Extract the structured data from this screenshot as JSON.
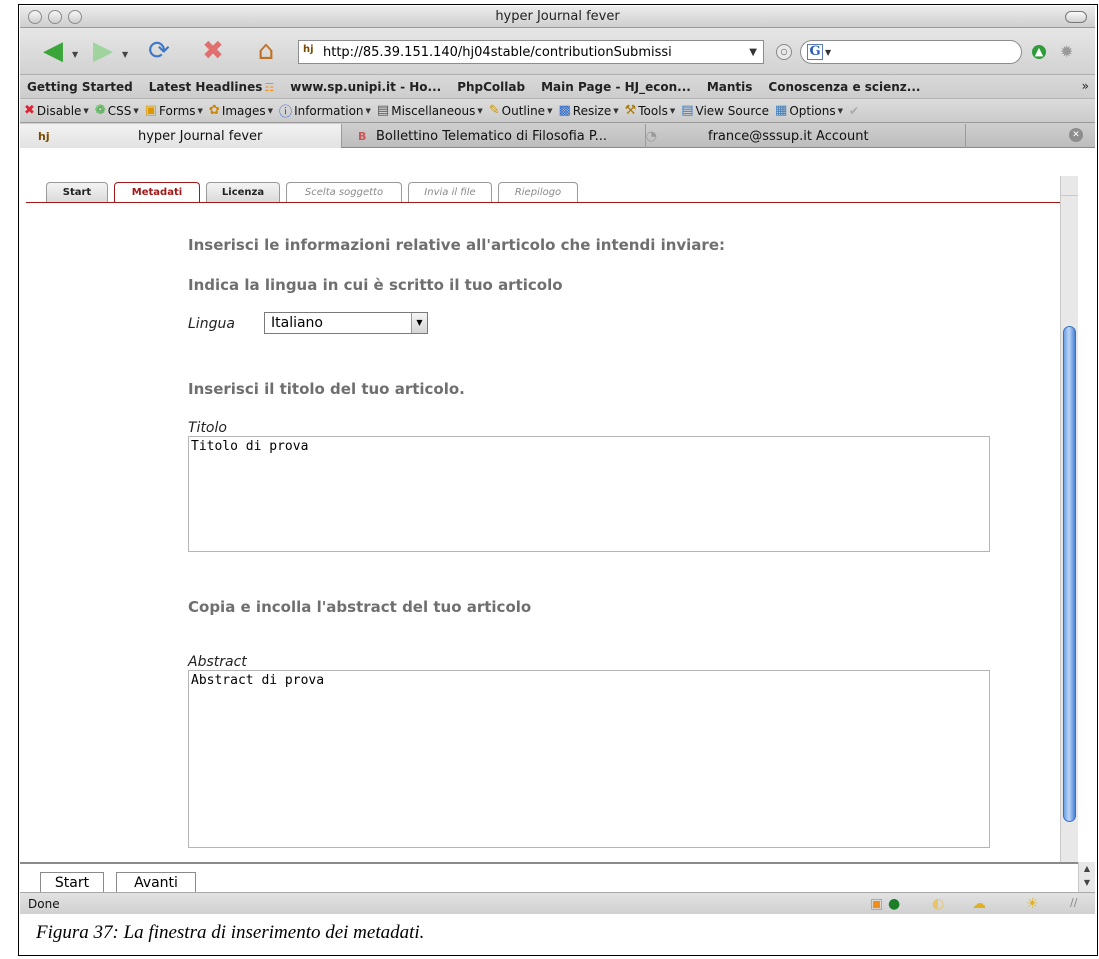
{
  "window": {
    "title": "hyper Journal fever"
  },
  "navigation": {
    "url": "http://85.39.151.140/hj04stable/contributionSubmissi",
    "search_engine": "G"
  },
  "bookmarks": [
    "Getting Started",
    "Latest Headlines",
    "www.sp.unipi.it - Ho...",
    "PhpCollab",
    "Main Page - HJ_econ...",
    "Mantis",
    "Conoscenza e scienz..."
  ],
  "devtoolbar": [
    {
      "label": "Disable",
      "icon": "disable-icon"
    },
    {
      "label": "CSS",
      "icon": "css-icon"
    },
    {
      "label": "Forms",
      "icon": "forms-icon"
    },
    {
      "label": "Images",
      "icon": "images-icon"
    },
    {
      "label": "Information",
      "icon": "information-icon"
    },
    {
      "label": "Miscellaneous",
      "icon": "miscellaneous-icon"
    },
    {
      "label": "Outline",
      "icon": "outline-icon"
    },
    {
      "label": "Resize",
      "icon": "resize-icon"
    },
    {
      "label": "Tools",
      "icon": "tools-icon"
    },
    {
      "label": "View Source",
      "icon": "view-source-icon"
    },
    {
      "label": "Options",
      "icon": "options-icon"
    }
  ],
  "browser_tabs": [
    {
      "label": "hyper Journal fever",
      "active": true
    },
    {
      "label": "Bollettino Telematico di Filosofia P...",
      "active": false
    },
    {
      "label": "france@sssup.it Account",
      "active": false
    }
  ],
  "page_tabs": [
    "Start",
    "Metadati",
    "Licenza",
    "Scelta soggetto",
    "Invia il file",
    "Riepilogo"
  ],
  "form": {
    "intro": "Inserisci le informazioni relative all'articolo che intendi inviare:",
    "language_heading": "Indica la lingua in cui è scritto il tuo articolo",
    "language_label": "Lingua",
    "language_value": "Italiano",
    "title_heading": "Inserisci il titolo del tuo articolo.",
    "title_label": "Titolo",
    "title_value": "Titolo di prova",
    "abstract_heading": "Copia e incolla l'abstract del tuo articolo",
    "abstract_label": "Abstract",
    "abstract_value": "Abstract di prova"
  },
  "buttons": {
    "start": "Start",
    "next": "Avanti"
  },
  "status": "Done",
  "caption": "Figura 37: La finestra di inserimento dei metadati."
}
